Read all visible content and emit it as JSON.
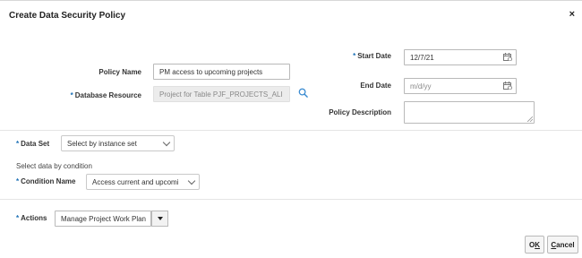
{
  "dialog": {
    "title": "Create Data Security Policy",
    "close_glyph": "×"
  },
  "form": {
    "policy_name": {
      "label": "Policy Name",
      "value": "PM access to upcoming projects"
    },
    "database_resource": {
      "required_mark": "*",
      "label": "Database Resource",
      "value": "Project for Table PJF_PROJECTS_ALI",
      "icon": "search-icon"
    },
    "start_date": {
      "required_mark": "*",
      "label": "Start Date",
      "value": "12/7/21",
      "icon": "calendar-icon"
    },
    "end_date": {
      "label": "End Date",
      "placeholder": "m/d/yy",
      "icon": "calendar-icon"
    },
    "policy_description": {
      "label": "Policy Description",
      "value": ""
    }
  },
  "data_set": {
    "required_mark": "*",
    "label": "Data Set",
    "selected": "Select by instance set"
  },
  "condition": {
    "hint": "Select data by condition",
    "required_mark": "*",
    "label": "Condition Name",
    "selected": "Access current and upcomi"
  },
  "actions": {
    "required_mark": "*",
    "label": "Actions",
    "value": "Manage Project Work Plan"
  },
  "buttons": {
    "ok": {
      "prefix": "O",
      "mnemonic": "K"
    },
    "cancel": {
      "mnemonic": "C",
      "rest": "ancel"
    }
  },
  "colors": {
    "required": "#1a6fb5",
    "search_icon": "#3a8bd1"
  }
}
